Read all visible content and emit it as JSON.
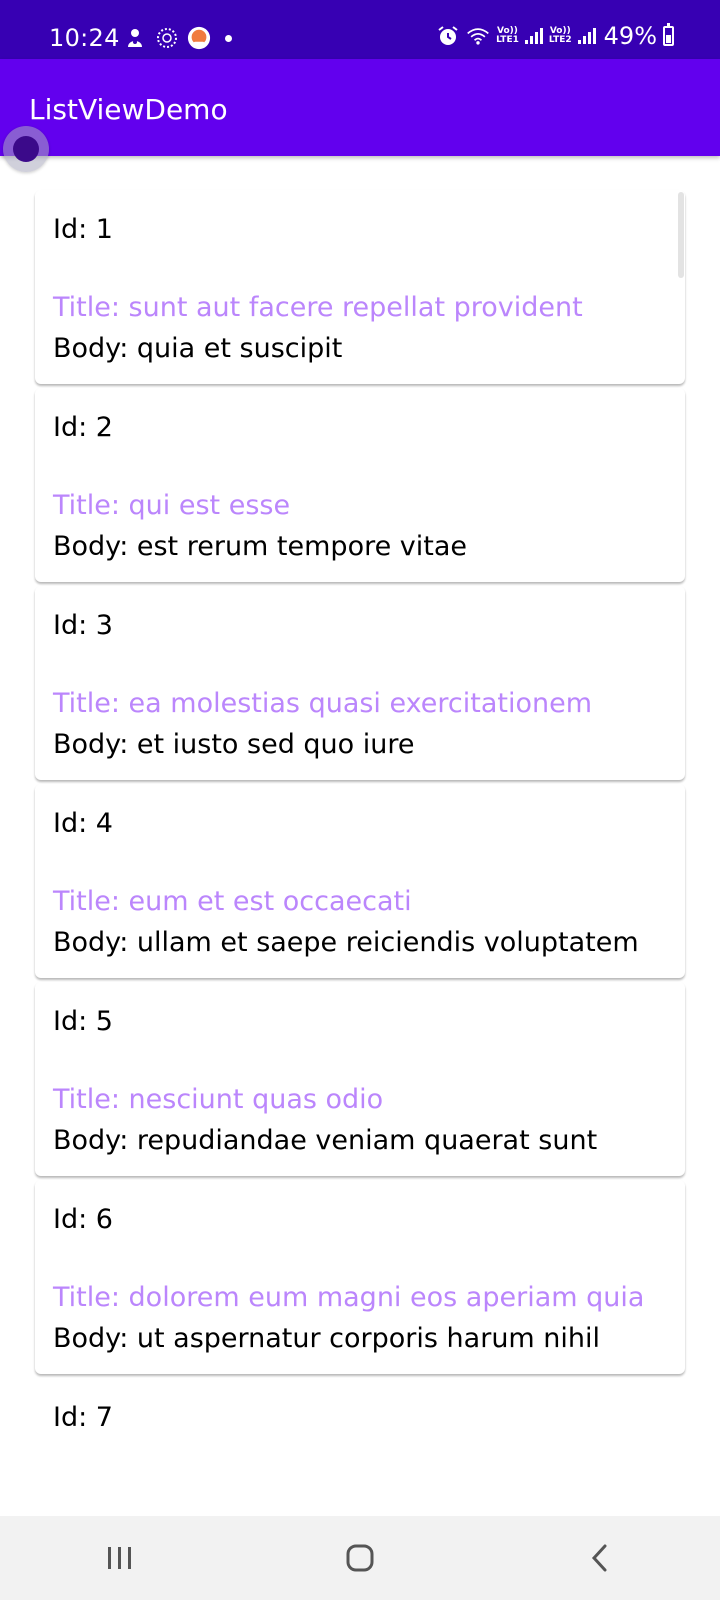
{
  "status_bar": {
    "time": "10:24",
    "net1_label_top": "Vo))",
    "net1_label_bottom": "LTE1",
    "net2_label_top": "Vo))",
    "net2_label_bottom": "LTE2",
    "battery": "49%",
    "icons": [
      "usb-debug-icon",
      "sync-icon",
      "notification-app-icon",
      "alarm-icon",
      "wifi-icon",
      "signal-icon",
      "battery-charging-icon"
    ]
  },
  "app_bar": {
    "title": "ListViewDemo"
  },
  "posts": [
    {
      "id": "Id: 1",
      "title": "Title: sunt aut facere repellat provident",
      "body": "Body: quia et suscipit"
    },
    {
      "id": "Id: 2",
      "title": "Title: qui est esse",
      "body": "Body: est rerum tempore vitae"
    },
    {
      "id": "Id: 3",
      "title": "Title: ea molestias quasi exercitationem",
      "body": "Body: et iusto sed quo iure"
    },
    {
      "id": "Id: 4",
      "title": "Title: eum et est occaecati",
      "body": "Body: ullam et saepe reiciendis voluptatem"
    },
    {
      "id": "Id: 5",
      "title": "Title: nesciunt quas odio",
      "body": "Body: repudiandae veniam quaerat sunt"
    },
    {
      "id": "Id: 6",
      "title": "Title: dolorem eum magni eos aperiam quia",
      "body": "Body: ut aspernatur corporis harum nihil"
    },
    {
      "id": "Id: 7"
    }
  ],
  "colors": {
    "status_bar": "#3700b3",
    "app_bar": "#6200ee",
    "title_text": "#bb86fc",
    "nav_bar": "#f2f2f2"
  },
  "nav_bar": {
    "buttons": [
      "recent-apps-icon",
      "home-icon",
      "back-icon"
    ]
  }
}
